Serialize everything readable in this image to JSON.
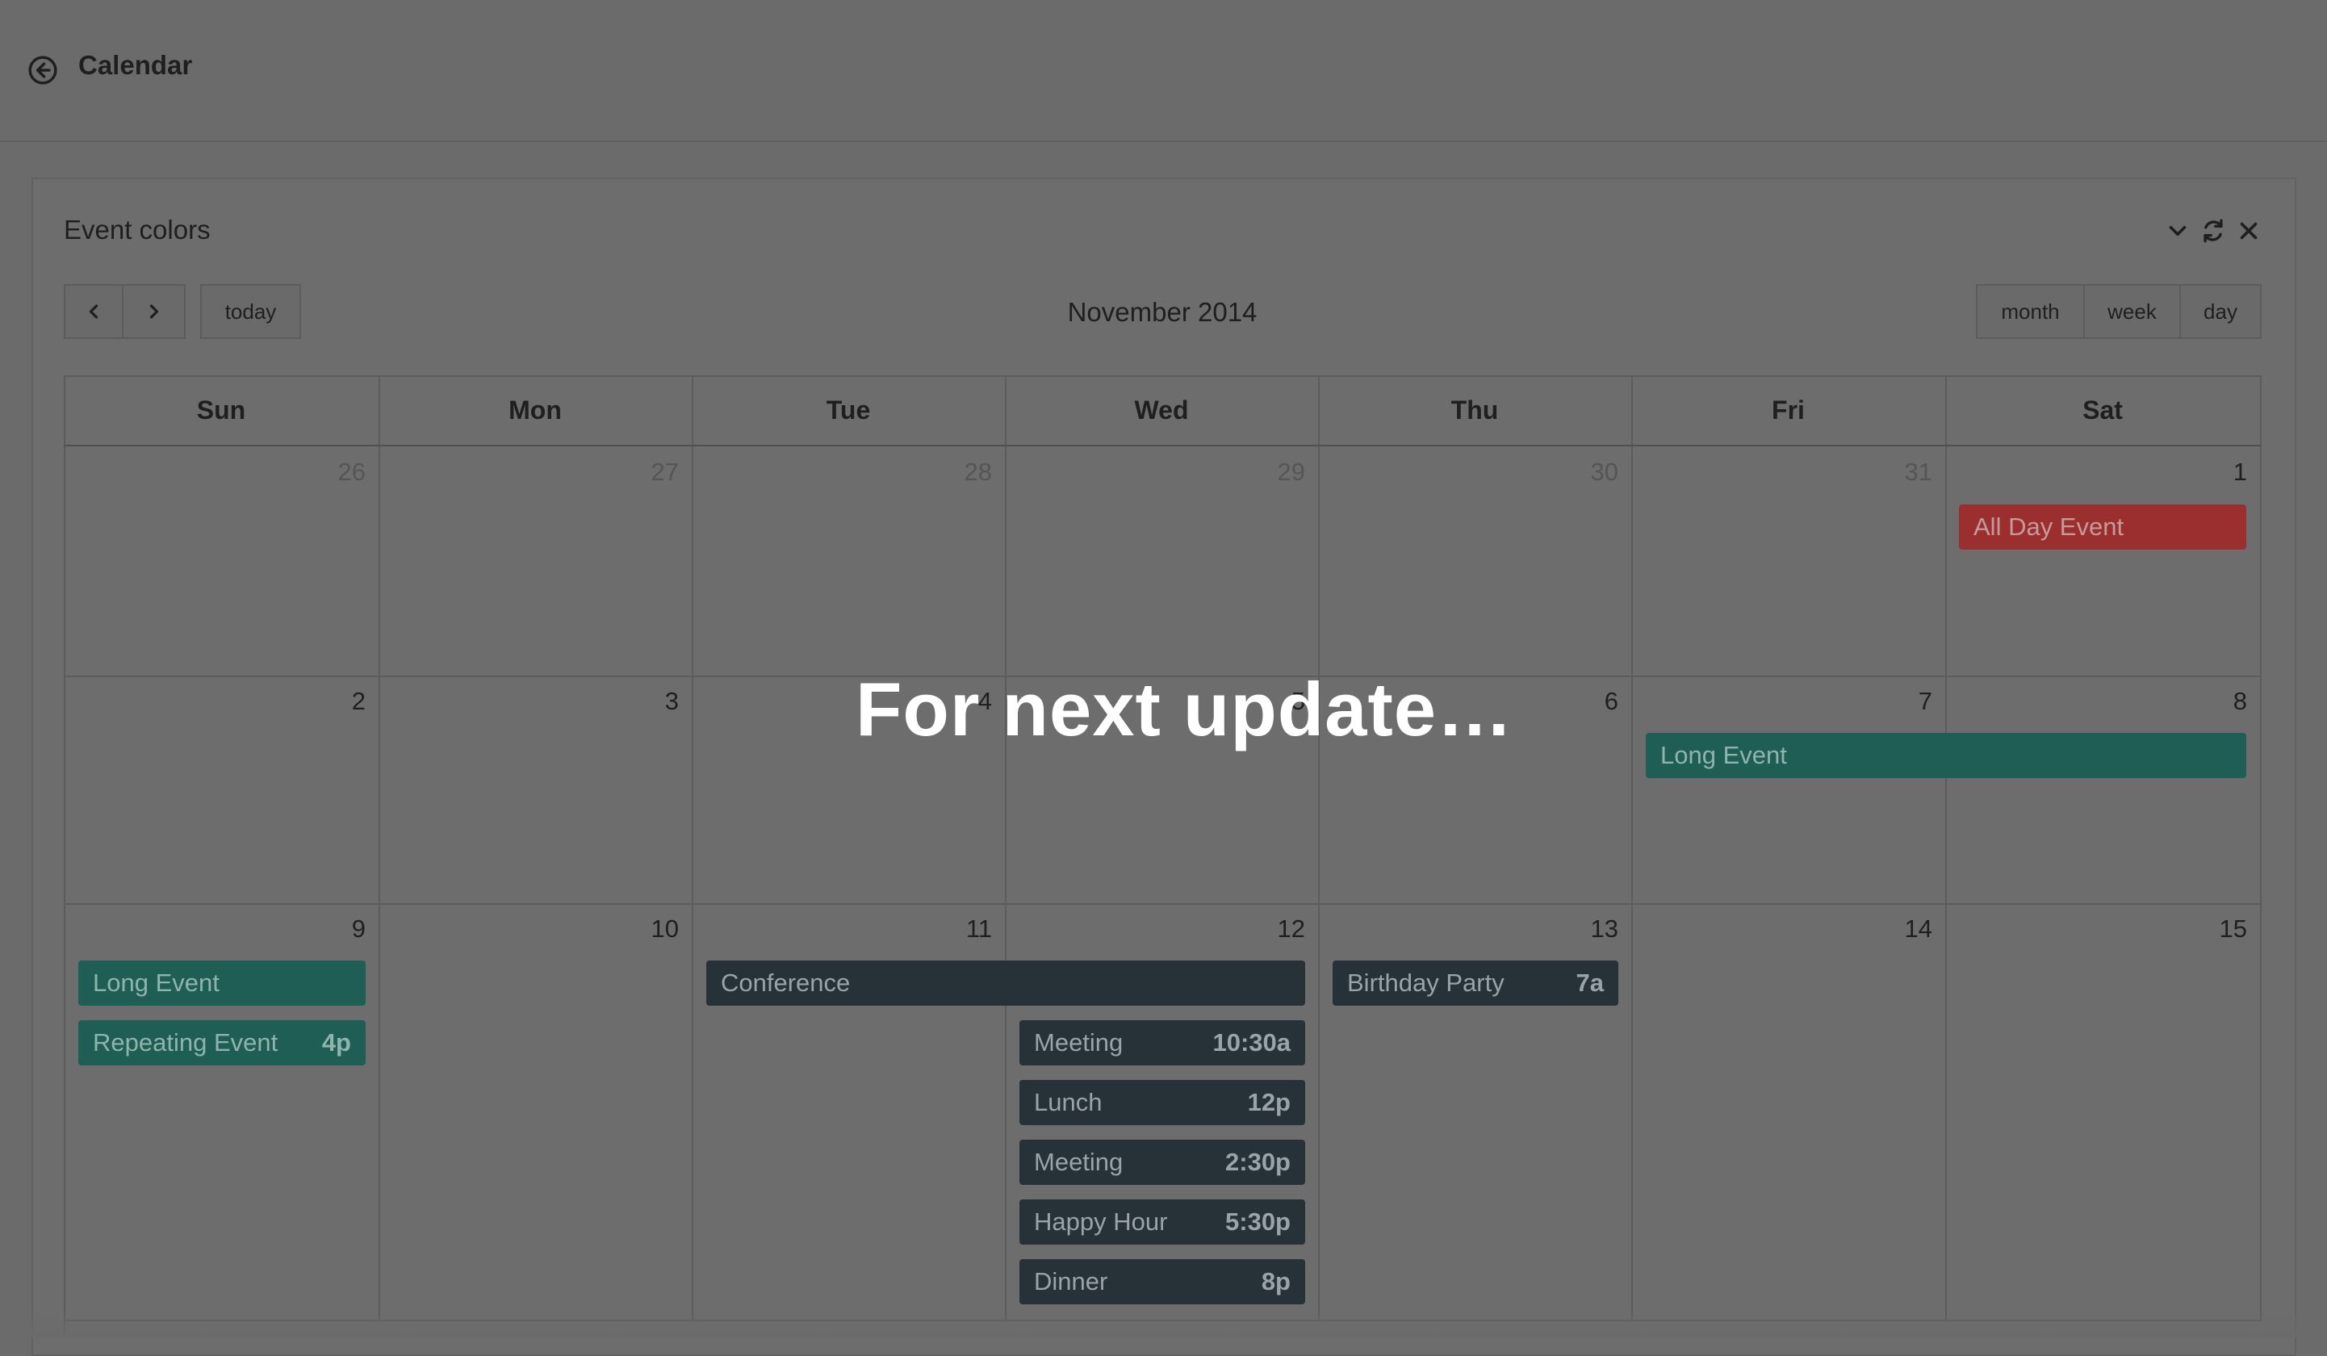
{
  "app": {
    "title": "Calendar",
    "back_icon": "arrow-circle-left-icon"
  },
  "card": {
    "title": "Event colors",
    "tools": [
      "chevron-down-icon",
      "refresh-icon",
      "close-icon"
    ]
  },
  "toolbar": {
    "prev_icon": "chevron-left-icon",
    "next_icon": "chevron-right-icon",
    "today_label": "today",
    "title": "November 2014",
    "views": [
      "month",
      "week",
      "day"
    ]
  },
  "weekdays": [
    "Sun",
    "Mon",
    "Tue",
    "Wed",
    "Thu",
    "Fri",
    "Sat"
  ],
  "weeks": [
    [
      {
        "d": "26",
        "other": true
      },
      {
        "d": "27",
        "other": true
      },
      {
        "d": "28",
        "other": true
      },
      {
        "d": "29",
        "other": true
      },
      {
        "d": "30",
        "other": true
      },
      {
        "d": "31",
        "other": true
      },
      {
        "d": "1",
        "other": false
      }
    ],
    [
      {
        "d": "2",
        "other": false
      },
      {
        "d": "3",
        "other": false
      },
      {
        "d": "4",
        "other": false
      },
      {
        "d": "5",
        "other": false
      },
      {
        "d": "6",
        "other": false
      },
      {
        "d": "7",
        "other": false
      },
      {
        "d": "8",
        "other": false
      }
    ],
    [
      {
        "d": "9",
        "other": false
      },
      {
        "d": "10",
        "other": false
      },
      {
        "d": "11",
        "other": false
      },
      {
        "d": "12",
        "other": false
      },
      {
        "d": "13",
        "other": false
      },
      {
        "d": "14",
        "other": false
      },
      {
        "d": "15",
        "other": false
      }
    ]
  ],
  "events": {
    "all_day": {
      "title": "All Day Event",
      "time": ""
    },
    "long_event_1": {
      "title": "Long Event",
      "time": ""
    },
    "long_event_2": {
      "title": "Long Event",
      "time": ""
    },
    "repeating": {
      "title": "Repeating Event",
      "time": "4p"
    },
    "conference": {
      "title": "Conference",
      "time": ""
    },
    "birthday": {
      "title": "Birthday Party",
      "time": "7a"
    },
    "meeting_1": {
      "title": "Meeting",
      "time": "10:30a"
    },
    "lunch": {
      "title": "Lunch",
      "time": "12p"
    },
    "meeting_2": {
      "title": "Meeting",
      "time": "2:30p"
    },
    "happy_hour": {
      "title": "Happy Hour",
      "time": "5:30p"
    },
    "dinner": {
      "title": "Dinner",
      "time": "8p"
    }
  },
  "overlay": {
    "text": "For next update…"
  },
  "colors": {
    "event_red": "#9b2f2f",
    "event_teal": "#1f5e55",
    "event_dark": "#263238"
  }
}
